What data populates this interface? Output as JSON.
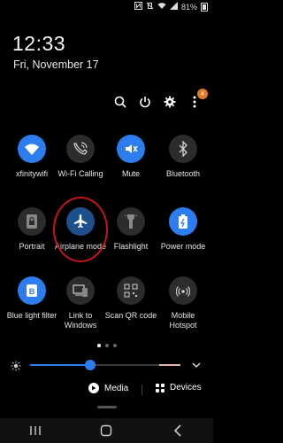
{
  "status": {
    "battery": "81%"
  },
  "clock": {
    "time": "12:33",
    "date": "Fri, November 17"
  },
  "header": {
    "notification_badge": "4"
  },
  "tiles": [
    {
      "label": "xfinitywifi",
      "state": "on",
      "icon": "wifi-icon"
    },
    {
      "label": "Wi-Fi Calling",
      "state": "off",
      "icon": "wifi-calling-icon"
    },
    {
      "label": "Mute",
      "state": "on",
      "icon": "mute-icon"
    },
    {
      "label": "Bluetooth",
      "state": "off",
      "icon": "bluetooth-icon"
    },
    {
      "label": "Portrait",
      "state": "off",
      "icon": "portrait-lock-icon"
    },
    {
      "label": "Airplane mode",
      "state": "off",
      "icon": "airplane-icon"
    },
    {
      "label": "Flashlight",
      "state": "off",
      "icon": "flashlight-icon"
    },
    {
      "label": "Power mode",
      "state": "on",
      "icon": "power-mode-icon"
    },
    {
      "label": "Blue light filter",
      "state": "on",
      "icon": "blue-light-filter-icon"
    },
    {
      "label": "Link to Windows",
      "state": "off",
      "icon": "link-to-windows-icon"
    },
    {
      "label": "Scan QR code",
      "state": "off",
      "icon": "qr-code-icon"
    },
    {
      "label": "Mobile Hotspot",
      "state": "off",
      "icon": "hotspot-icon"
    }
  ],
  "pager": {
    "pages": 3,
    "active": 0
  },
  "brightness": {
    "level": 0.4
  },
  "media": {
    "media_label": "Media",
    "devices_label": "Devices"
  },
  "colors": {
    "accent": "#2c7df0",
    "highlight": "#c9131a",
    "badge": "#e07b2b"
  }
}
